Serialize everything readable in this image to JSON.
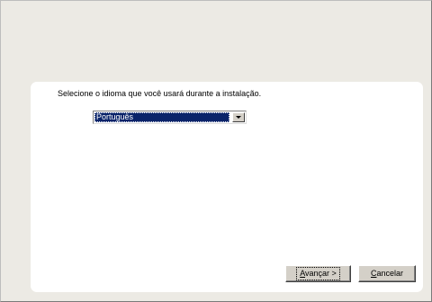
{
  "installer": {
    "prompt": "Selecione o idioma que você usará durante a instalação.",
    "language_select": {
      "selected": "Português"
    },
    "buttons": {
      "next": {
        "mnemonic": "A",
        "rest": "vançar >"
      },
      "cancel": {
        "mnemonic": "C",
        "rest": "ancelar"
      }
    }
  },
  "icons": {
    "dropdown": "chevron-down-icon"
  },
  "colors": {
    "selection": "#0a246a",
    "panel_bg": "#ffffff",
    "window_bg": "#eceae4",
    "button_face": "#d4d0c8"
  }
}
